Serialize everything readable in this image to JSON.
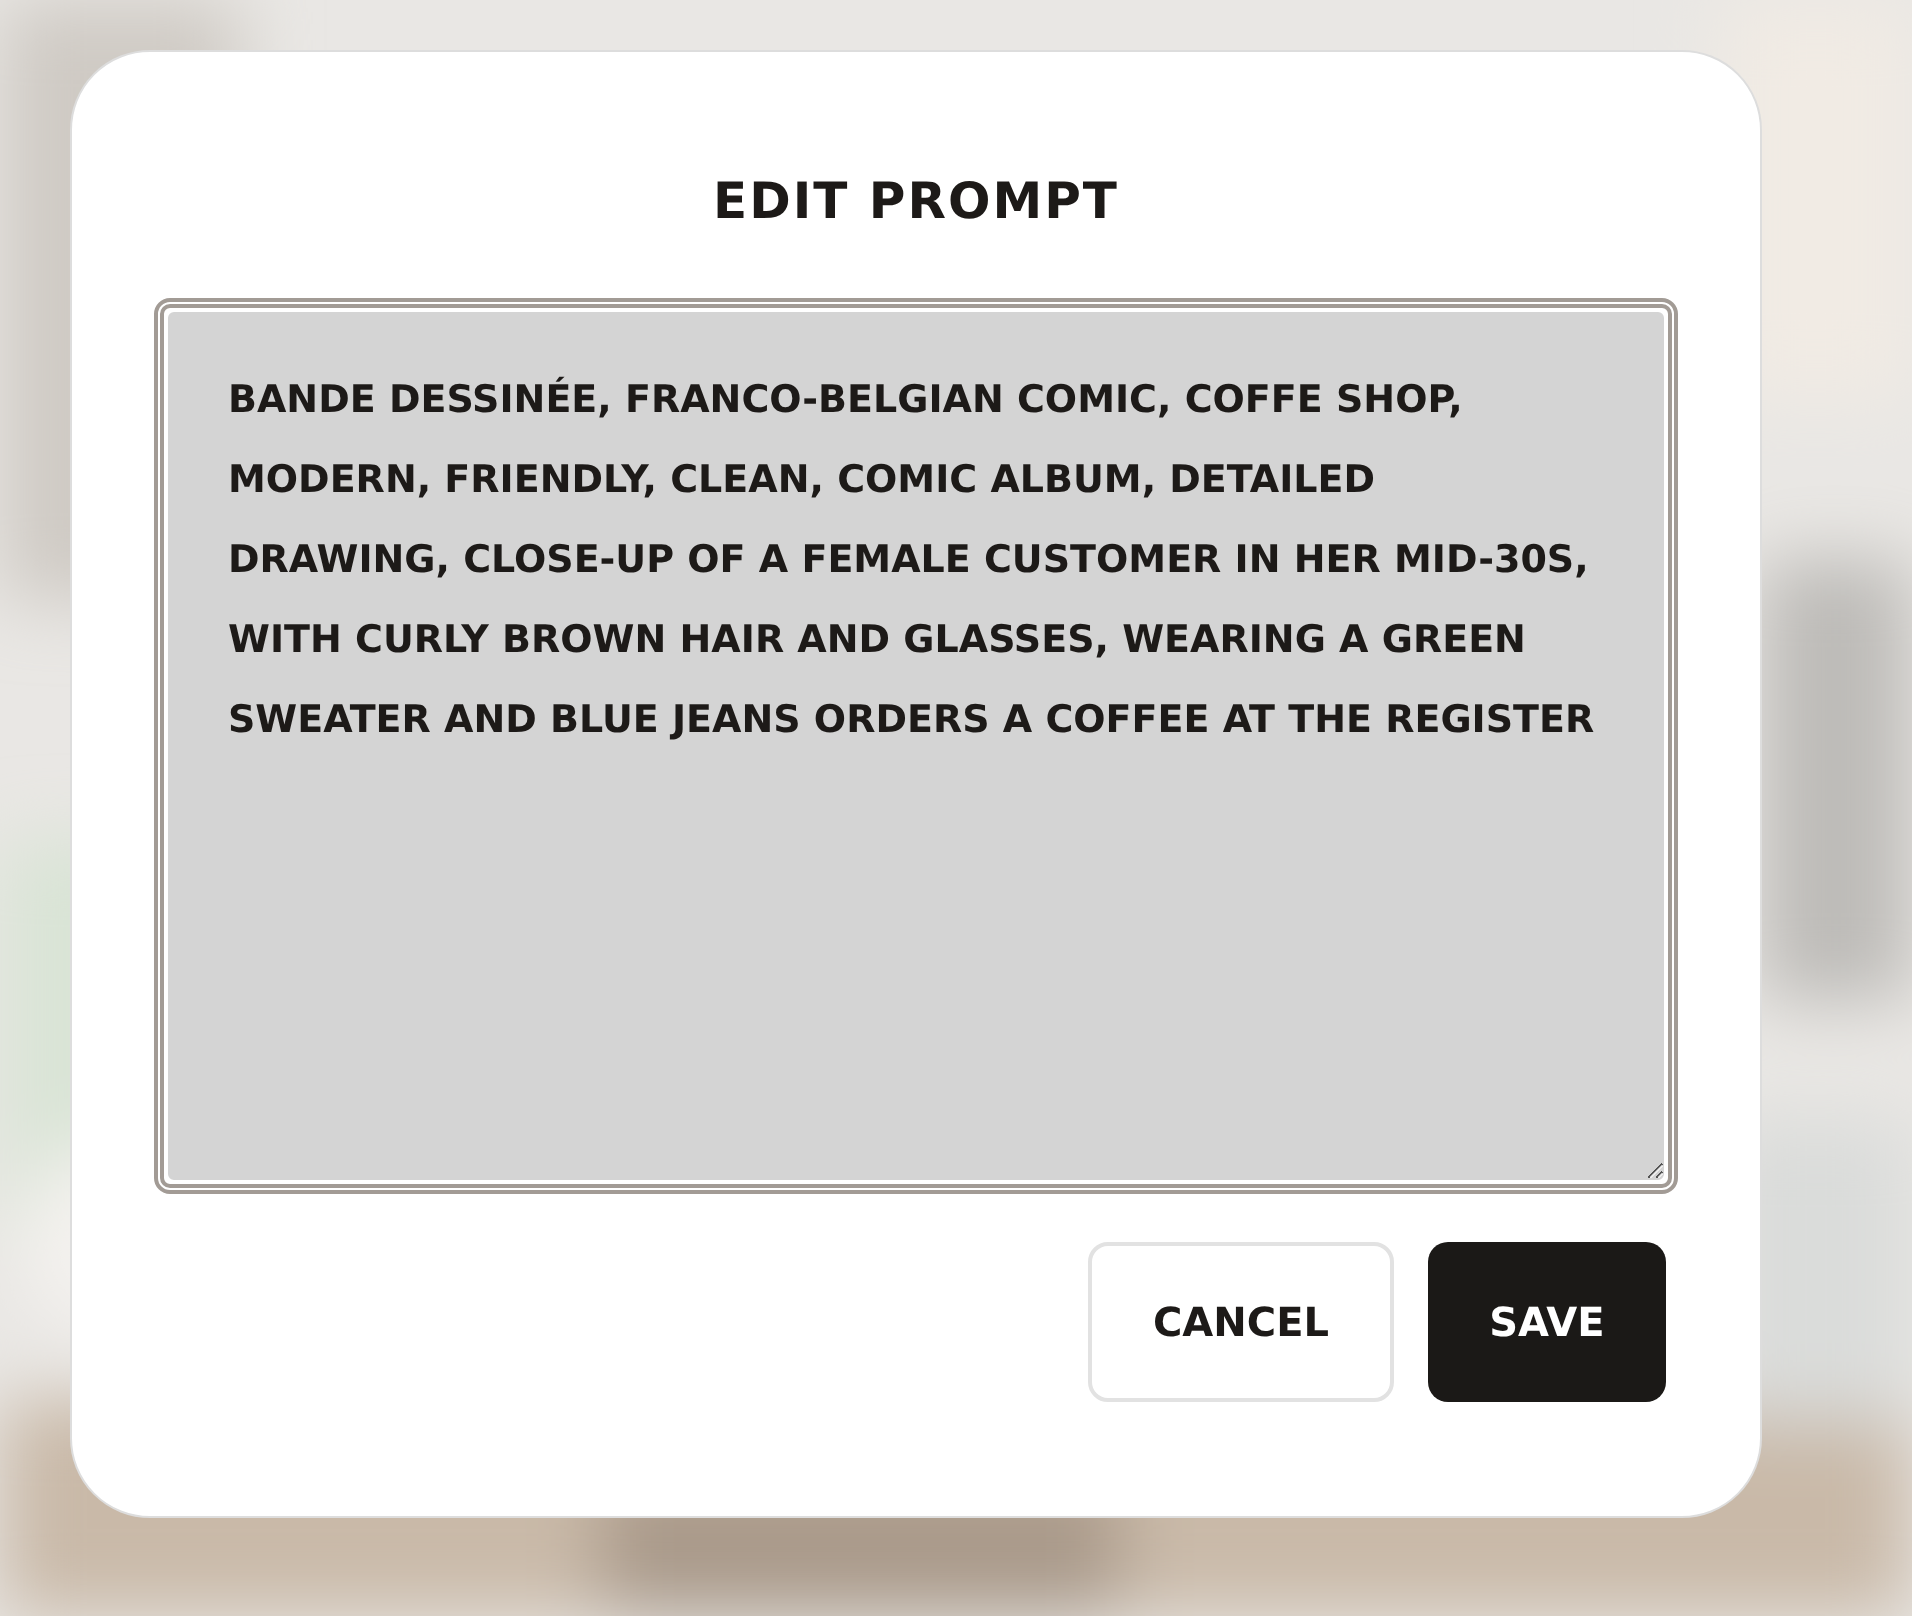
{
  "dialog": {
    "title": "EDIT PROMPT",
    "prompt": {
      "value": "BANDE DESSINÉE, FRANCO-BELGIAN COMIC, COFFE SHOP, MODERN, FRIENDLY, CLEAN, COMIC ALBUM, DETAILED DRAWING, CLOSE-UP OF A FEMALE CUSTOMER IN HER MID-30S, WITH CURLY BROWN HAIR AND GLASSES, WEARING A GREEN SWEATER AND BLUE JEANS ORDERS A COFFEE AT THE REGISTER"
    },
    "buttons": [
      {
        "label": "CANCEL",
        "kind": "secondary"
      },
      {
        "label": "SAVE",
        "kind": "primary"
      }
    ]
  }
}
